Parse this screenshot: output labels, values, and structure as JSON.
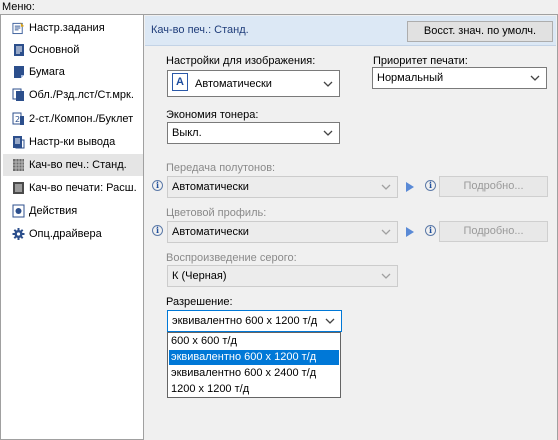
{
  "menu_caption": "Меню:",
  "sidebar": {
    "items": [
      {
        "label": "Настр.задания"
      },
      {
        "label": "Основной"
      },
      {
        "label": "Бумага"
      },
      {
        "label": "Обл./Рзд.лст/Ст.мрк."
      },
      {
        "label": "2-ст./Компон./Буклет"
      },
      {
        "label": "Настр-ки вывода"
      },
      {
        "label": "Кач-во печ.: Станд."
      },
      {
        "label": "Кач-во печати: Расш."
      },
      {
        "label": "Действия"
      },
      {
        "label": "Опц.драйвера"
      }
    ],
    "selected_index": 6
  },
  "header": {
    "title": "Кач-во печ.: Станд.",
    "reset_label": "Восст. знач. по умолч."
  },
  "image_settings": {
    "label": "Настройки для изображения:",
    "value": "Автоматически",
    "icon_letter": "A"
  },
  "print_priority": {
    "label": "Приоритет печати:",
    "value": "Нормальный"
  },
  "toner_saving": {
    "label": "Экономия тонера:",
    "value": "Выкл."
  },
  "halftone": {
    "label": "Передача полутонов:",
    "value": "Автоматически",
    "details": "Подробно..."
  },
  "color_profile": {
    "label": "Цветовой профиль:",
    "value": "Автоматически",
    "details": "Подробно..."
  },
  "gray_reproduction": {
    "label": "Воспроизведение серого:",
    "value": "К (Черная)"
  },
  "resolution": {
    "label": "Разрешение:",
    "value": "эквивалентно 600 x 1200 т/д",
    "options": [
      "600 x 600 т/д",
      "эквивалентно 600 x 1200 т/д",
      "эквивалентно 600 x 2400 т/д",
      "1200 x 1200 т/д"
    ],
    "highlighted_index": 1
  },
  "colors": {
    "header_bg": "#dce8f5",
    "selection": "#0078d7",
    "title_text": "#1f3d7a"
  }
}
